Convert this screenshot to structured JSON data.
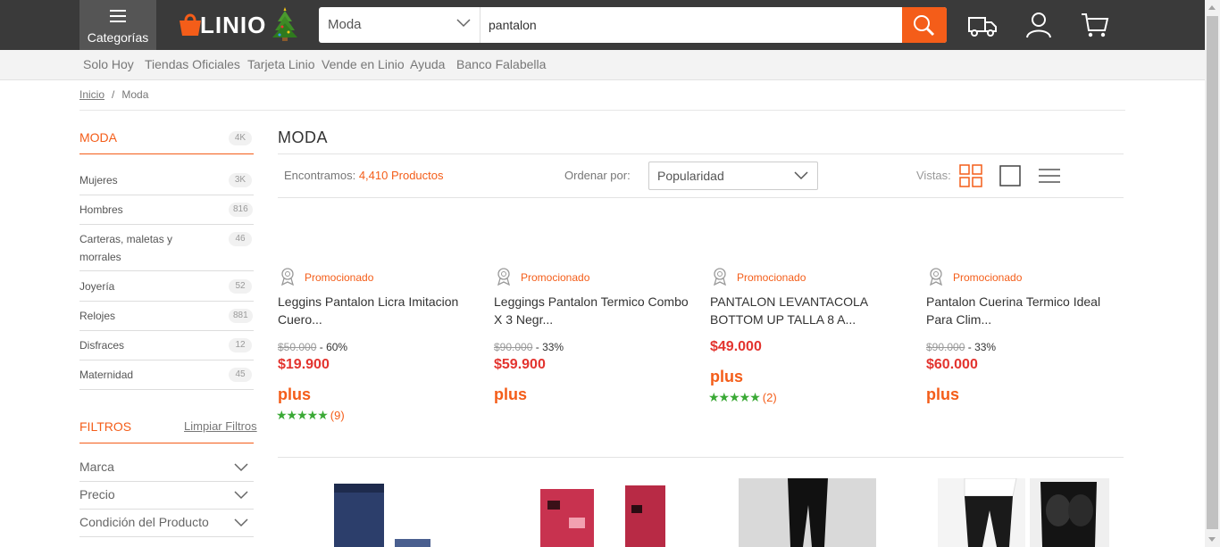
{
  "header": {
    "categories_label": "Categorías",
    "logo_text": "LINIO",
    "search": {
      "category": "Moda",
      "query": "pantalon"
    }
  },
  "subnav": [
    "Solo Hoy",
    "Tiendas Oficiales",
    "Tarjeta Linio",
    "Vende en Linio",
    "Ayuda",
    "Banco Falabella"
  ],
  "breadcrumb": {
    "home": "Inicio",
    "sep": "/",
    "current": "Moda"
  },
  "sidebar": {
    "heading": "MODA",
    "heading_count": "4K",
    "categories": [
      {
        "label": "Mujeres",
        "count": "3K"
      },
      {
        "label": "Hombres",
        "count": "816"
      },
      {
        "label": "Carteras, maletas y morrales",
        "count": "46"
      },
      {
        "label": "Joyería",
        "count": "52"
      },
      {
        "label": "Relojes",
        "count": "881"
      },
      {
        "label": "Disfraces",
        "count": "12"
      },
      {
        "label": "Maternidad",
        "count": "45"
      }
    ],
    "filters_heading": "FILTROS",
    "clear_filters": "Limpiar Filtros",
    "filters": [
      "Marca",
      "Precio",
      "Condición del Producto"
    ]
  },
  "main": {
    "title": "MODA",
    "found_prefix": "Encontramos:",
    "found_count": "4,410 Productos",
    "sort_label": "Ordenar por:",
    "sort_value": "Popularidad",
    "views_label": "Vistas:",
    "products": [
      {
        "promo": "Promocionado",
        "title": "Leggins Pantalon Licra Imitacion Cuero...",
        "old_price": "$50.000",
        "discount": "- 60%",
        "price": "$19.900",
        "plus": "plus",
        "rating": 5,
        "reviews": "(9)"
      },
      {
        "promo": "Promocionado",
        "title": "Leggings Pantalon Termico Combo X 3 Negr...",
        "old_price": "$90.000",
        "discount": "- 33%",
        "price": "$59.900",
        "plus": "plus",
        "rating": null,
        "reviews": ""
      },
      {
        "promo": "Promocionado",
        "title": "PANTALON LEVANTACOLA BOTTOM UP TALLA 8 A...",
        "old_price": "",
        "discount": "",
        "price": "$49.000",
        "plus": "plus",
        "rating": 5,
        "reviews": "(2)"
      },
      {
        "promo": "Promocionado",
        "title": "Pantalon Cuerina Termico Ideal Para Clim...",
        "old_price": "$90.000",
        "discount": "- 33%",
        "price": "$60.000",
        "plus": "plus",
        "rating": null,
        "reviews": ""
      }
    ]
  },
  "colors": {
    "brand": "#f45d19",
    "topbar": "#3a3a3a",
    "price": "#e3342f",
    "stars": "#3aa935"
  }
}
